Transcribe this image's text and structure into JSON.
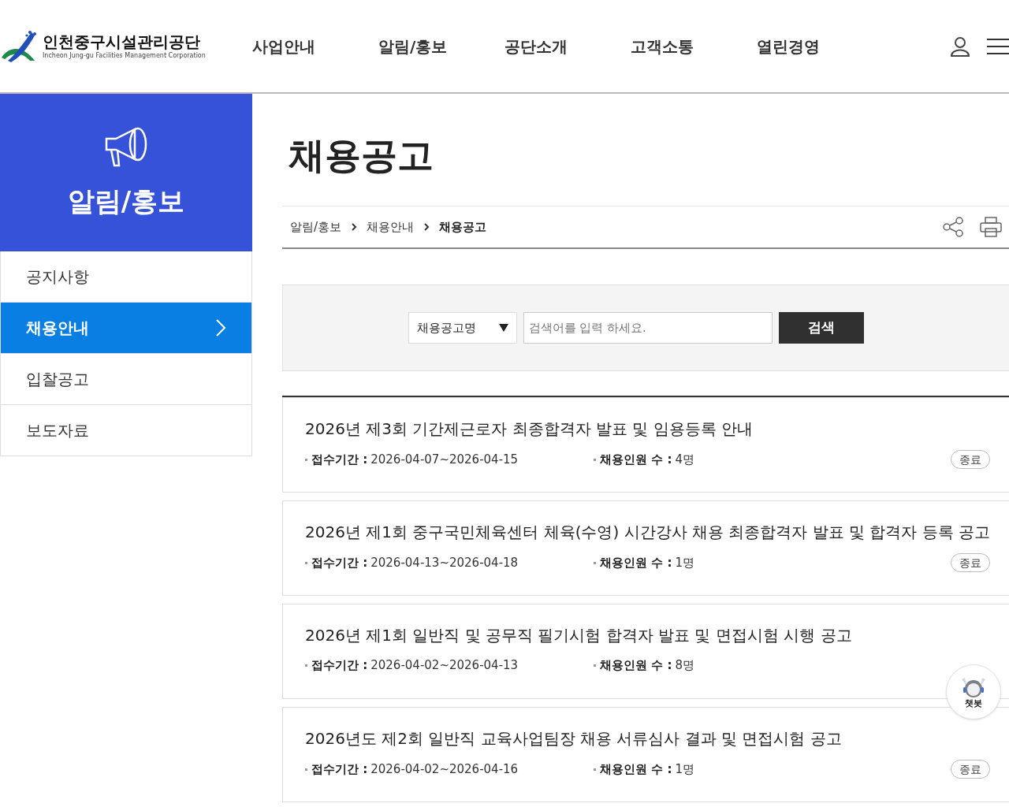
{
  "header": {
    "logo": {
      "name": "인천중구시설관리공단",
      "subtitle": "Incheon Jung-gu Facilities Management Corporation"
    },
    "nav": [
      {
        "label": "사업안내",
        "selected": false
      },
      {
        "label": "알림/홍보",
        "selected": false
      },
      {
        "label": "공단소개",
        "selected": false
      },
      {
        "label": "고객소통",
        "selected": false
      },
      {
        "label": "열린경영",
        "selected": false
      }
    ]
  },
  "sidebar": {
    "title": "알림/홍보",
    "items": [
      {
        "label": "공지사항",
        "selected": false
      },
      {
        "label": "채용안내",
        "selected": true
      },
      {
        "label": "입찰공고",
        "selected": false
      },
      {
        "label": "보도자료",
        "selected": false
      }
    ]
  },
  "page_title": "채용공고",
  "breadcrumb": [
    {
      "label": "알림/홍보",
      "current": false
    },
    {
      "label": "채용안내",
      "current": false
    },
    {
      "label": "채용공고",
      "current": true
    }
  ],
  "search": {
    "category": "채용공고명",
    "placeholder": "검색어를 입력 하세요.",
    "button": "검색"
  },
  "postings": [
    {
      "title": "2026년 제3회 기간제근로자 최종합격자 발표 및 임용등록 안내",
      "period_label": "접수기간 :",
      "period": "2026-04-07~2026-04-15",
      "count_label": "채용인원 수 :",
      "count": "4명",
      "status": "종료"
    },
    {
      "title": "2026년 제1회 중구국민체육센터 체육(수영) 시간강사 채용 최종합격자 발표 및 합격자 등록 공고",
      "period_label": "접수기간 :",
      "period": "2026-04-13~2026-04-18",
      "count_label": "채용인원 수 :",
      "count": "1명",
      "status": "종료"
    },
    {
      "title": "2026년 제1회 일반직 및 공무직 필기시험 합격자 발표 및 면접시험 시행 공고",
      "period_label": "접수기간 :",
      "period": "2026-04-02~2026-04-13",
      "count_label": "채용인원 수 :",
      "count": "8명"
    },
    {
      "title": "2026년도 제2회 일반직 교육사업팀장 채용 서류심사 결과 및 면접시험 공고",
      "period_label": "접수기간 :",
      "period": "2026-04-02~2026-04-16",
      "count_label": "채용인원 수 :",
      "count": "1명",
      "status": "종료"
    }
  ],
  "chatbot": {
    "label": "챗봇"
  }
}
